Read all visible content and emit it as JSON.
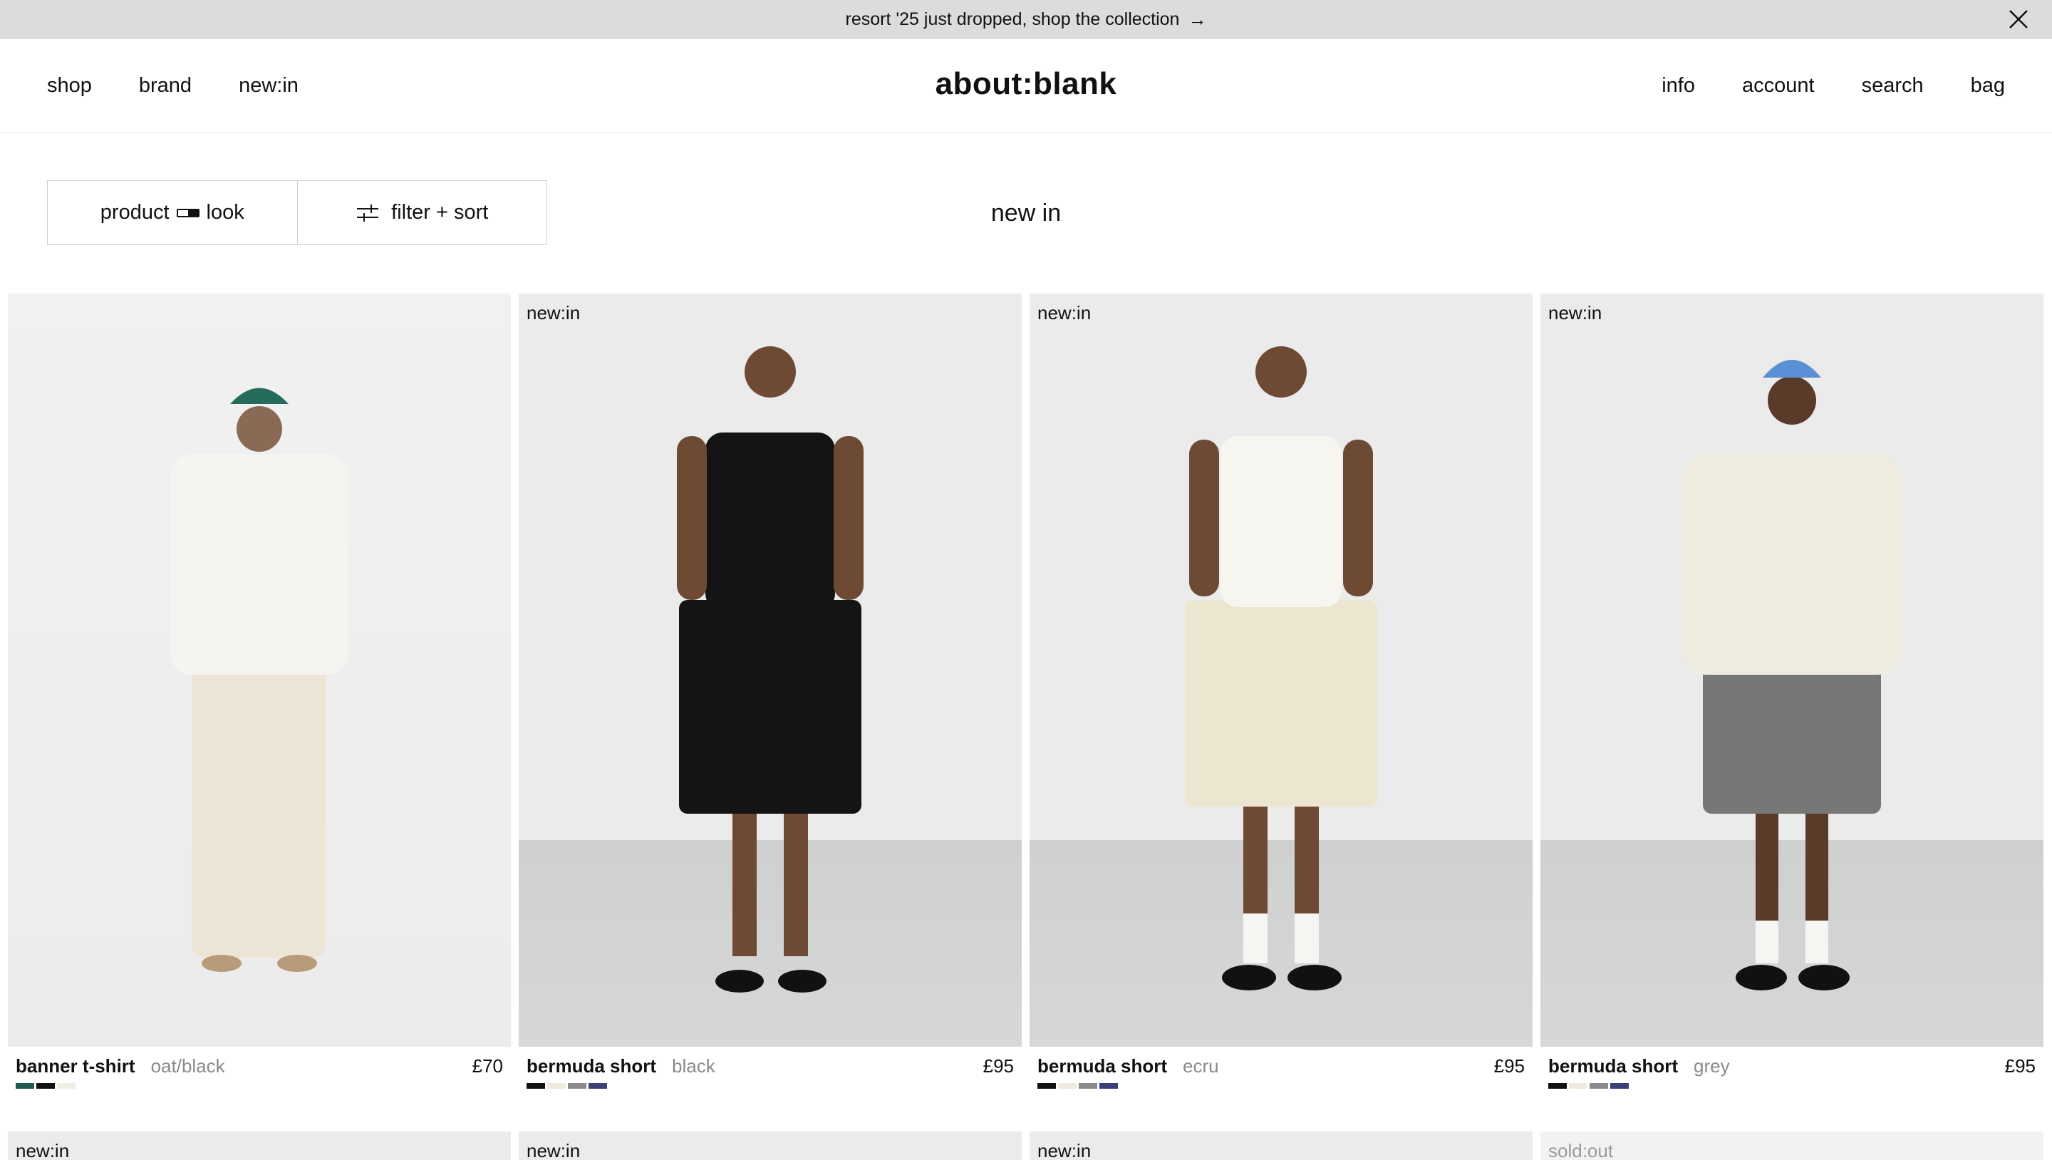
{
  "announcement": {
    "text": "resort '25 just dropped, shop the collection",
    "arrow": "→",
    "close_icon": "close-icon"
  },
  "header": {
    "logo": "about:blank",
    "nav_left": [
      "shop",
      "brand",
      "new:in"
    ],
    "nav_right": [
      "info",
      "account",
      "search",
      "bag"
    ]
  },
  "toolbar": {
    "view_product": "product",
    "view_look": "look",
    "filter_label": "filter + sort"
  },
  "page_title": "new in",
  "products": [
    {
      "badge": "",
      "name": "banner t-shirt",
      "color": "oat/black",
      "price": "£70",
      "swatches": [
        "#1f5a4f",
        "#111111",
        "#f0ede4"
      ],
      "cap": "#246b5c",
      "top": "#f5f4f0",
      "bottom": "#ece4d4"
    },
    {
      "badge": "new:in",
      "name": "bermuda short",
      "color": "black",
      "price": "£95",
      "swatches": [
        "#111111",
        "#efeadc",
        "#8a8a8a",
        "#3b3f7a"
      ],
      "cap": "",
      "top": "#141414",
      "bottom": "#141414"
    },
    {
      "badge": "new:in",
      "name": "bermuda short",
      "color": "ecru",
      "price": "£95",
      "swatches": [
        "#111111",
        "#efeadc",
        "#8a8a8a",
        "#3b3f7a"
      ],
      "cap": "",
      "top": "#f7f5ef",
      "bottom": "#ece5cf"
    },
    {
      "badge": "new:in",
      "name": "bermuda short",
      "color": "grey",
      "price": "£95",
      "swatches": [
        "#111111",
        "#efeadc",
        "#8a8a8a",
        "#3b3f7a"
      ],
      "cap": "#5b8fd6",
      "top": "#efebdf",
      "bottom": "#777876"
    }
  ],
  "row2_badges": [
    "new:in",
    "new:in",
    "new:in",
    "sold:out"
  ]
}
